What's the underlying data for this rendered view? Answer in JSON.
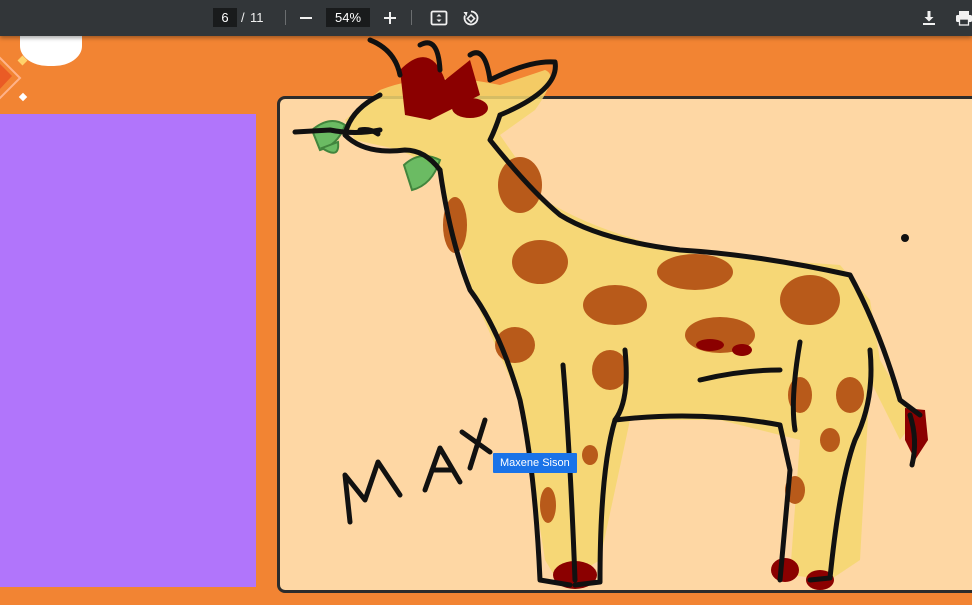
{
  "toolbar": {
    "current_page": "6",
    "page_separator": "/",
    "total_pages": "11",
    "zoom_level": "54%",
    "icons": [
      "zoom-out-icon",
      "zoom-in-icon",
      "fit-page-icon",
      "rotate-icon",
      "download-icon",
      "print-icon"
    ]
  },
  "canvas": {
    "handwritten_text": "MAX",
    "collaborator_tooltip": "Maxene Sison"
  },
  "colors": {
    "toolbar_bg": "#323639",
    "page_bg": "#f28433",
    "purple_panel": "#b175fb",
    "canvas_bg": "#fed7a4",
    "giraffe_fill": "#f5d76e",
    "giraffe_spots": "#b85a1a",
    "giraffe_dark": "#8b0000",
    "leaf_green": "#4caf50",
    "tooltip_bg": "#1a73e8"
  }
}
